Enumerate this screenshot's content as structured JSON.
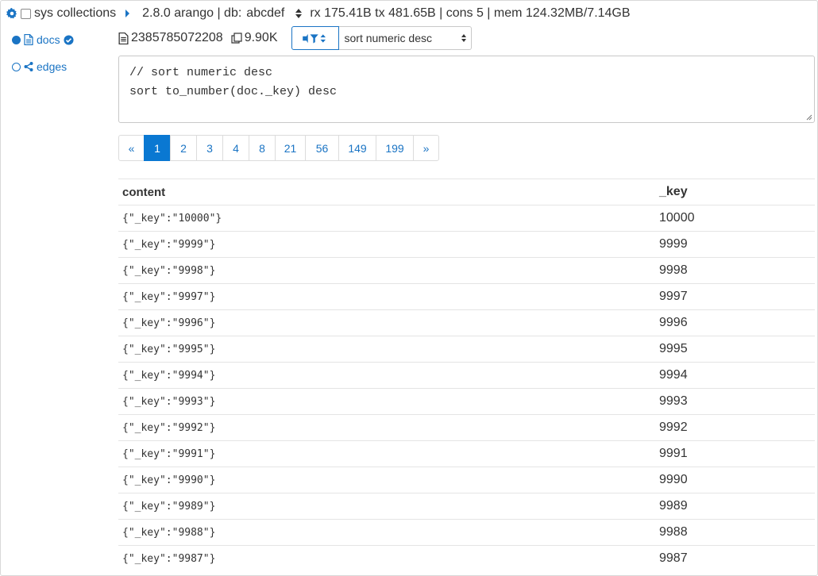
{
  "topbar": {
    "sys_label": "sys collections",
    "version_info": "2.8.0 arango | db:",
    "db_name": "abcdef",
    "stats_text": "rx 175.41B tx 481.65B | cons 5 | mem 124.32MB/7.14GB"
  },
  "sidebar": {
    "items": [
      {
        "label": "docs",
        "selected": true,
        "icon": "document-icon"
      },
      {
        "label": "edges",
        "selected": false,
        "icon": "share-icon"
      }
    ]
  },
  "collection": {
    "size_bytes": "2385785072208",
    "doc_count": "9.90K",
    "query_select": "sort numeric desc"
  },
  "query": {
    "lines": [
      "// sort numeric desc",
      "sort to_number(doc._key) desc"
    ]
  },
  "pagination": {
    "prev": "«",
    "pages": [
      "1",
      "2",
      "3",
      "4",
      "8",
      "21",
      "56",
      "149",
      "199"
    ],
    "active": "1",
    "next": "»"
  },
  "table": {
    "headers": [
      "content",
      "_key"
    ],
    "rows": [
      [
        "{\"_key\":\"10000\"}",
        "10000"
      ],
      [
        "{\"_key\":\"9999\"}",
        "9999"
      ],
      [
        "{\"_key\":\"9998\"}",
        "9998"
      ],
      [
        "{\"_key\":\"9997\"}",
        "9997"
      ],
      [
        "{\"_key\":\"9996\"}",
        "9996"
      ],
      [
        "{\"_key\":\"9995\"}",
        "9995"
      ],
      [
        "{\"_key\":\"9994\"}",
        "9994"
      ],
      [
        "{\"_key\":\"9993\"}",
        "9993"
      ],
      [
        "{\"_key\":\"9992\"}",
        "9992"
      ],
      [
        "{\"_key\":\"9991\"}",
        "9991"
      ],
      [
        "{\"_key\":\"9990\"}",
        "9990"
      ],
      [
        "{\"_key\":\"9989\"}",
        "9989"
      ],
      [
        "{\"_key\":\"9988\"}",
        "9988"
      ],
      [
        "{\"_key\":\"9987\"}",
        "9987"
      ]
    ]
  },
  "colors": {
    "accent": "#1a74c4",
    "active_page": "#0a78d2"
  }
}
